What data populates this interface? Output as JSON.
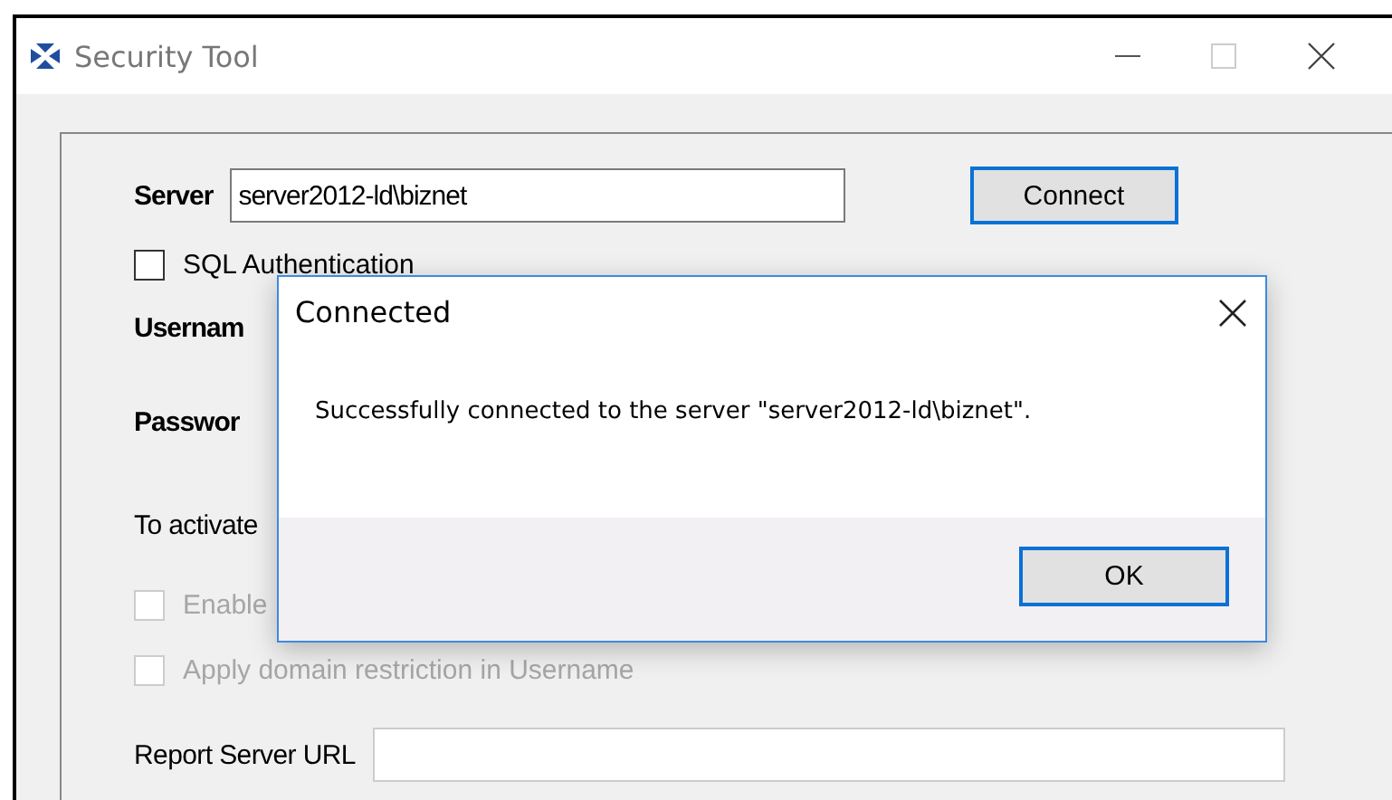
{
  "window": {
    "title": "Security Tool"
  },
  "form": {
    "server_label": "Server",
    "server_value": "server2012-ld\\biznet",
    "connect_button": "Connect",
    "checkboxes": [
      {
        "label": "SQL Authentication",
        "checked": false,
        "disabled": false
      }
    ],
    "username_label": "Usernam",
    "password_label": "Passwor",
    "activate_text": "To activate",
    "options": [
      {
        "label": "Enable",
        "checked": false,
        "disabled": true
      },
      {
        "label": "Apply domain restriction in Username",
        "checked": false,
        "disabled": true
      }
    ],
    "report_label": "Report Server URL"
  },
  "dialog": {
    "title": "Connected",
    "message": "Successfully connected to the server \"server2012-ld\\biznet\".",
    "button": "OK"
  }
}
